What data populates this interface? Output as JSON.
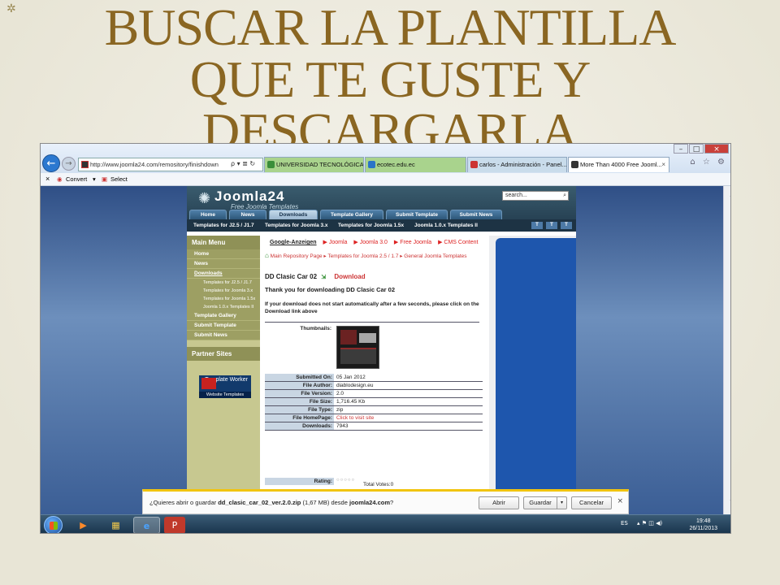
{
  "slide": {
    "title_lines": [
      "BUSCAR LA PLANTILLA",
      "QUE TE GUSTE Y",
      "DESCARGARLA"
    ],
    "bullet": "✲"
  },
  "browser": {
    "address": "http://www.joomla24.com/remository/finishdown",
    "address_domain": "joomla24.com",
    "address_tools": "ρ ▾ ≣ ↻",
    "tabs": [
      {
        "label": "UNIVERSIDAD TECNOLÓGICA ...",
        "color": "#3a8e3a"
      },
      {
        "label": "ecotec.edu.ec",
        "color": "#2a74c8"
      },
      {
        "label": "carlos - Administración - Panel...",
        "color": "#c33"
      },
      {
        "label": "More Than 4000 Free Jooml...",
        "color": "#333"
      }
    ],
    "tab_close": "×",
    "window_buttons": [
      "–",
      "□",
      "×"
    ],
    "toolbar_icons": "⌂ ☆ ⚙",
    "back_glyph": "←",
    "fwd_glyph": "→",
    "cmd": {
      "close": "×",
      "convert": "Convert",
      "dropdown": "▾",
      "select": "Select"
    }
  },
  "site": {
    "logo": "Joomla24",
    "logo_tagline": "Free Joomla Templates",
    "search_placeholder": "search...",
    "nav": [
      "Home",
      "News",
      "Downloads",
      "Template Gallery",
      "Submit Template",
      "Submit News"
    ],
    "subnav": [
      "Templates for J2.5 / J1.7",
      "Templates for Joomla 3.x",
      "Templates for Joomla 1.5x",
      "Joomla 1.0.x Templates II"
    ],
    "text_size_buttons": [
      "T",
      "T",
      "T"
    ],
    "left_menu_title": "Main Menu",
    "left_menu": [
      "Home",
      "News",
      "Downloads"
    ],
    "left_sub": [
      "Templates for J2.5 / J1.7",
      "Templates for Joomla 3.x",
      "Templates for Joomla 1.5x",
      "Joomla 1.0.x Templates II"
    ],
    "left_menu_more": [
      "Template Gallery",
      "Submit Template",
      "Submit News"
    ],
    "partner_title": "Partner Sites",
    "partner_logo_title": "Template Worker",
    "partner_logo_sub": "Website Templates",
    "ads_title": "Google-Anzeigen",
    "ads": [
      "▶ Joomla",
      "▶ Joomla 3.0",
      "▶ Free Joomla",
      "▶ CMS Content"
    ],
    "breadcrumb": "Main Repository Page ▸ Templates for Joomla 2.5 / 1.7 ▸ General Joomla Templates",
    "doc_title": "DD Clasic Car 02",
    "download_label": "Download",
    "thanks": "Thank you for downloading DD Clasic Car 02",
    "note": "If your download does not start automatically after a few seconds, please click on the Download link above",
    "thumbnails_label": "Thumbnails:",
    "meta": [
      {
        "k": "Submitted On:",
        "v": "05 Jan 2012"
      },
      {
        "k": "File Author:",
        "v": "diablodesign.eu"
      },
      {
        "k": "File Version:",
        "v": "2.0"
      },
      {
        "k": "File Size:",
        "v": "1,716.45 Kb"
      },
      {
        "k": "File Type:",
        "v": "zip"
      },
      {
        "k": "File HomePage:",
        "v": "Click to visit site"
      },
      {
        "k": "Downloads:",
        "v": "7943"
      }
    ],
    "rating_label": "Rating:",
    "rating_stars": "○○○○○",
    "total_votes": "Total Votes:0"
  },
  "download_bar": {
    "prefix": "¿Quieres abrir o guardar ",
    "filename": "dd_clasic_car_02_ver.2.0.zip",
    "middle": " (1,67 MB) desde ",
    "source": "joomla24.com",
    "suffix": "?",
    "open": "Abrir",
    "save": "Guardar",
    "save_arrow": "▾",
    "cancel": "Cancelar",
    "close": "×"
  },
  "taskbar": {
    "items": [
      "▶",
      "▦",
      "e",
      "P"
    ],
    "lang": "ES",
    "tray_icons": "▴ ⚑ ◫ ◀)",
    "time": "19:48",
    "date": "26/11/2013"
  },
  "scroll": {
    "up": "▲",
    "down": "▼"
  }
}
